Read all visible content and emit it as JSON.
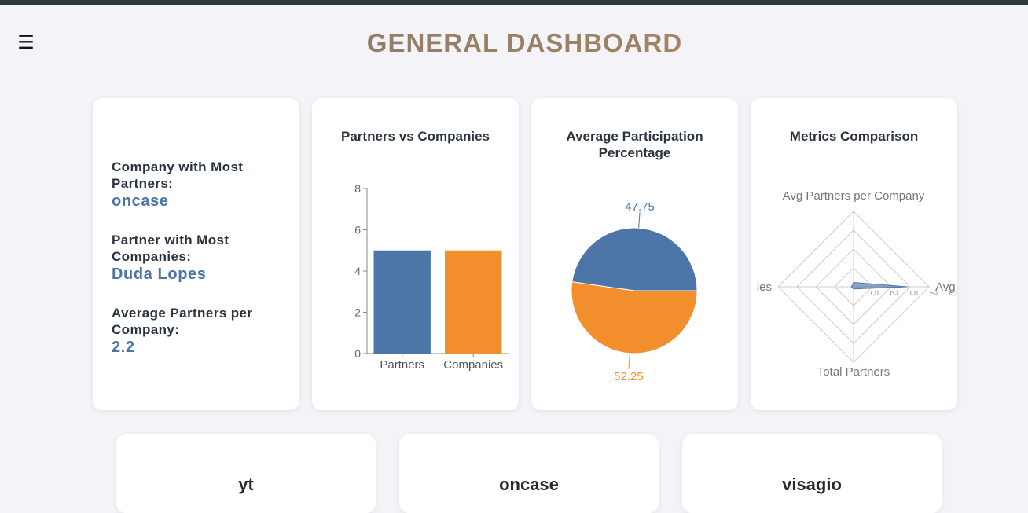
{
  "header": {
    "title": "GENERAL DASHBOARD",
    "menu_icon": "☰"
  },
  "stats": [
    {
      "label": "Company with Most Partners:",
      "value": "oncase"
    },
    {
      "label": "Partner with Most Companies:",
      "value": "Duda Lopes"
    },
    {
      "label": "Average Partners per Company:",
      "value": "2.2"
    }
  ],
  "colors": {
    "blue": "#4d76a8",
    "orange": "#f28e2b",
    "grid": "#cccccc"
  },
  "chart_data": [
    {
      "type": "bar",
      "title": "Partners vs Companies",
      "categories": [
        "Partners",
        "Companies"
      ],
      "values": [
        5,
        5
      ],
      "ylim": [
        0,
        8
      ],
      "yticks": [
        "0",
        "2",
        "4",
        "6",
        "8"
      ]
    },
    {
      "type": "pie",
      "title": "Average Participation Percentage",
      "values": [
        47.75,
        52.25
      ],
      "labels": [
        "47.75",
        "52.25"
      ]
    },
    {
      "type": "radar",
      "title": "Metrics Comparison",
      "axes": [
        "Avg Partners per Company",
        "Avg",
        "Total Partners",
        "ies"
      ],
      "values": [
        0.4,
        5.0,
        0.2,
        0.2
      ],
      "rmax": 7,
      "ticks": [
        "5",
        "2",
        "5",
        "7",
        "0"
      ]
    }
  ],
  "company_cards": [
    "yt",
    "oncase",
    "visagio"
  ]
}
